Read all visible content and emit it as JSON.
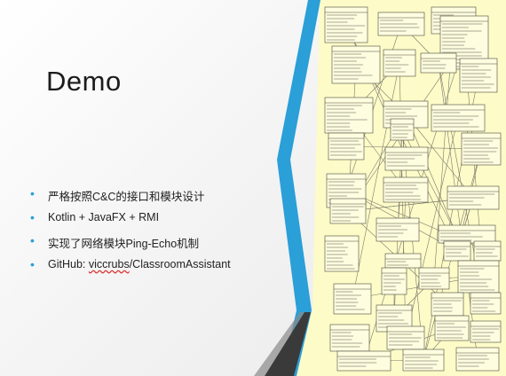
{
  "slide": {
    "title": "Demo",
    "bullets": [
      "严格按照C&C的接口和模块设计",
      "Kotlin + JavaFX + RMI",
      "实现了网络模块Ping-Echo机制"
    ],
    "github": {
      "prefix": "GitHub: ",
      "user": "viccrubs",
      "repo": "/ClassroomAssistant"
    }
  },
  "colors": {
    "accent": "#2a9fd8",
    "diagram_bg": "#fdfbc8",
    "dark_band": "#3a3a3a",
    "title": "#1c1c1c"
  },
  "icons": {
    "bullet": "bullet-dot-icon"
  }
}
